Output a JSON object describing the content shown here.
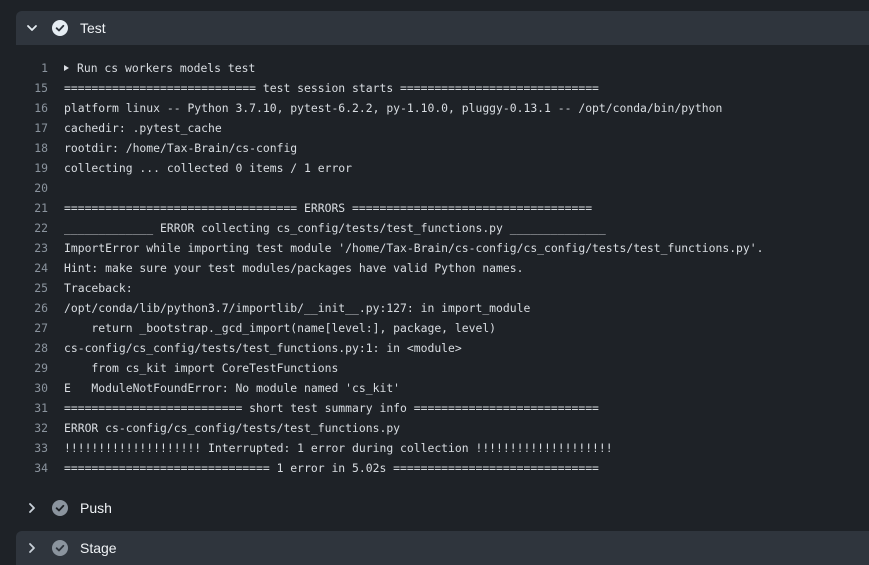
{
  "steps": [
    {
      "title": "Test",
      "state": "expanded",
      "status": "success"
    },
    {
      "title": "Push",
      "state": "collapsed",
      "status": "skipped"
    },
    {
      "title": "Stage",
      "state": "collapsed",
      "status": "skipped"
    }
  ],
  "log": {
    "group_line": {
      "num": "1",
      "text": "Run cs workers models test"
    },
    "lines": [
      {
        "num": "15",
        "text": "============================ test session starts ============================="
      },
      {
        "num": "16",
        "text": "platform linux -- Python 3.7.10, pytest-6.2.2, py-1.10.0, pluggy-0.13.1 -- /opt/conda/bin/python"
      },
      {
        "num": "17",
        "text": "cachedir: .pytest_cache"
      },
      {
        "num": "18",
        "text": "rootdir: /home/Tax-Brain/cs-config"
      },
      {
        "num": "19",
        "text": "collecting ... collected 0 items / 1 error"
      },
      {
        "num": "20",
        "text": ""
      },
      {
        "num": "21",
        "text": "================================== ERRORS ==================================="
      },
      {
        "num": "22",
        "text": "_____________ ERROR collecting cs_config/tests/test_functions.py ______________"
      },
      {
        "num": "23",
        "text": "ImportError while importing test module '/home/Tax-Brain/cs-config/cs_config/tests/test_functions.py'."
      },
      {
        "num": "24",
        "text": "Hint: make sure your test modules/packages have valid Python names."
      },
      {
        "num": "25",
        "text": "Traceback:"
      },
      {
        "num": "26",
        "text": "/opt/conda/lib/python3.7/importlib/__init__.py:127: in import_module"
      },
      {
        "num": "27",
        "text": "    return _bootstrap._gcd_import(name[level:], package, level)"
      },
      {
        "num": "28",
        "text": "cs-config/cs_config/tests/test_functions.py:1: in <module>"
      },
      {
        "num": "29",
        "text": "    from cs_kit import CoreTestFunctions"
      },
      {
        "num": "30",
        "text": "E   ModuleNotFoundError: No module named 'cs_kit'"
      },
      {
        "num": "31",
        "text": "========================== short test summary info ==========================="
      },
      {
        "num": "32",
        "text": "ERROR cs-config/cs_config/tests/test_functions.py"
      },
      {
        "num": "33",
        "text": "!!!!!!!!!!!!!!!!!!!! Interrupted: 1 error during collection !!!!!!!!!!!!!!!!!!!!"
      },
      {
        "num": "34",
        "text": "============================== 1 error in 5.02s =============================="
      }
    ]
  },
  "icons": {
    "expanded_chevron": "chevron-down-icon",
    "collapsed_chevron": "chevron-right-icon",
    "success": "check-circle-icon",
    "skipped": "check-circle-icon"
  },
  "colors": {
    "success_icon": "#e6edf3",
    "skipped_icon": "#8b949e",
    "header_bg": "#2f353d",
    "page_bg": "#1e2227"
  }
}
